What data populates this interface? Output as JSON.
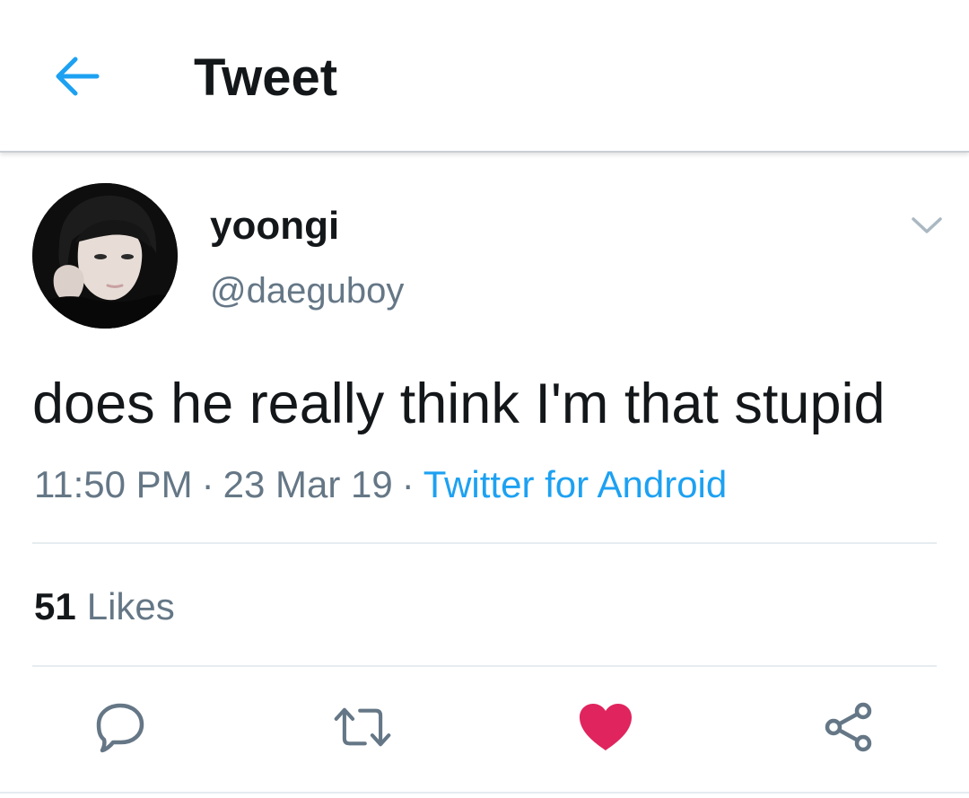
{
  "appbar": {
    "title": "Tweet",
    "back_icon": "arrow-left-icon",
    "accent_color": "#1da1f2"
  },
  "author": {
    "display_name": "yoongi",
    "handle": "@daeguboy",
    "avatar_icon": "avatar-photo",
    "menu_icon": "chevron-down-icon"
  },
  "tweet": {
    "text": "does he really think I'm that stupid",
    "time": "11:50 PM",
    "separator": "·",
    "date": "23 Mar 19",
    "source": "Twitter for Android"
  },
  "stats": {
    "likes_count": "51",
    "likes_label": "Likes"
  },
  "actions": {
    "reply_icon": "reply-icon",
    "retweet_icon": "retweet-icon",
    "like_icon": "heart-icon",
    "like_color": "#e0245e",
    "share_icon": "share-icon"
  }
}
